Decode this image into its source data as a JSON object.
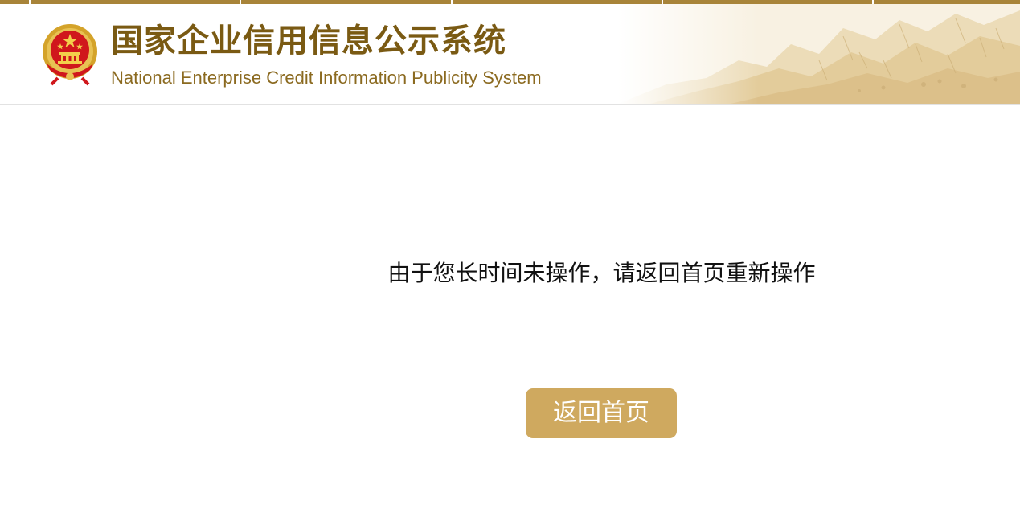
{
  "header": {
    "title": "国家企业信用信息公示系统",
    "subtitle": "National Enterprise Credit Information Publicity System",
    "emblem_icon": "national-emblem-icon",
    "decoration": "mountain-landscape"
  },
  "main": {
    "message": "由于您长时间未操作，请返回首页重新操作",
    "home_button_label": "返回首页"
  },
  "colors": {
    "top_bar": "#a88439",
    "title": "#7a5a13",
    "subtitle": "#8b6a20",
    "button_bg": "#cfa95f",
    "button_text": "#ffffff",
    "message_text": "#111111"
  }
}
